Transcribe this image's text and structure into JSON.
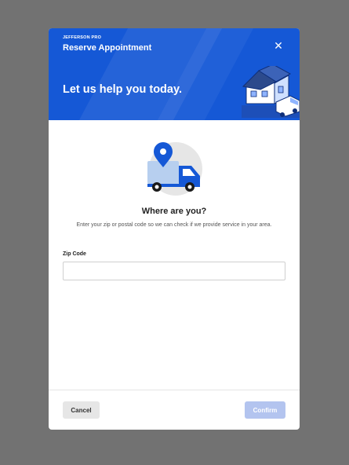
{
  "modal": {
    "brand": "JEFFERSON PRO",
    "title": "Reserve Appointment",
    "close_icon": "close-icon",
    "tagline": "Let us help you today.",
    "header_color": "#1558d6"
  },
  "body": {
    "illustration": "delivery-truck-with-location-pin",
    "heading": "Where are you?",
    "description": "Enter your zip or postal code so we can check if we provide service in your area.",
    "zip": {
      "label": "Zip Code",
      "value": "",
      "placeholder": ""
    }
  },
  "footer": {
    "cancel_label": "Cancel",
    "confirm_label": "Confirm",
    "confirm_state": "disabled"
  }
}
